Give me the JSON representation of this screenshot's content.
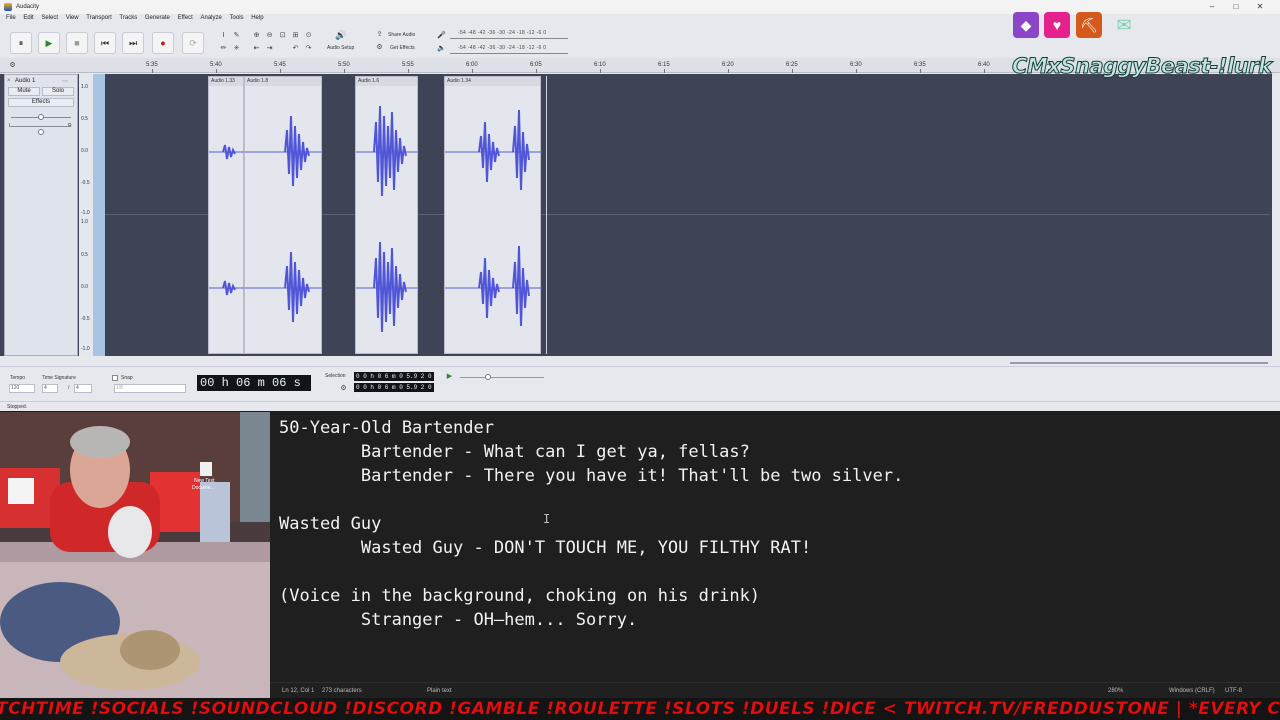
{
  "audacity": {
    "title": "Audacity",
    "menu": [
      "File",
      "Edit",
      "Select",
      "View",
      "Transport",
      "Tracks",
      "Generate",
      "Effect",
      "Analyze",
      "Tools",
      "Help"
    ],
    "toolbar": {
      "pause": "⏸",
      "play": "▶",
      "stop": "■",
      "skip_start": "⏮",
      "skip_end": "⏭",
      "record": "●",
      "loop": "⟳",
      "audio_setup": "Audio Setup",
      "share_audio": "Share Audio",
      "get_effects": "Get Effects",
      "meter_scale": "-54 -48 -42 -36 -30 -24 -18 -12 -6  0"
    },
    "ruler_ticks": [
      "5:35",
      "5:40",
      "5:45",
      "5:50",
      "5:55",
      "6:00",
      "6:05",
      "6:10",
      "6:15",
      "6:20",
      "6:25",
      "6:30",
      "6:35",
      "6:40",
      "6:45"
    ],
    "track": {
      "name": "Audio 1",
      "mute": "Mute",
      "solo": "Solo",
      "effects": "Effects",
      "gain_l": "L",
      "gain_r": "R",
      "scale": [
        "1.0",
        "0.5",
        "0.0",
        "-0.5",
        "-1.0",
        "1.0",
        "0.5",
        "0.0",
        "-0.5",
        "-1.0"
      ]
    },
    "clips": [
      {
        "name": "Audio 1.33"
      },
      {
        "name": "Audio 1.8"
      },
      {
        "name": "Audio 1.6"
      },
      {
        "name": "Audio 1.34"
      }
    ],
    "selection_bar": {
      "tempo_label": "Tempo",
      "tempo_value": "120",
      "time_sig_label": "Time Signature",
      "time_sig_num": "4",
      "time_sig_den": "4",
      "snap_label": "Snap",
      "snap_value": "1/8",
      "time_display": "00 h 06 m 06 s",
      "selection_label": "Selection",
      "sel_start": "0 0 h 0 6 m 0 5.9 2 0 s",
      "sel_end": "0 0 h 0 6 m 0 5.9 2 0 s"
    },
    "status": "Stopped."
  },
  "overlay": {
    "streamer_name": "CMxSnaggyBeast-!lurk",
    "icon_colors": {
      "gem": "#8c45c8",
      "heart": "#e5218c",
      "cart": "#d45a1c",
      "twitch": "#7ecfb3"
    }
  },
  "webcam": {
    "desktop_file_label_1": "New Text",
    "desktop_file_label_2": "Docume..."
  },
  "notepad": {
    "lines": [
      "50-Year-Old Bartender",
      "        Bartender - What can I get ya, fellas?",
      "        Bartender - There you have it! That'll be two silver.",
      "",
      "Wasted Guy",
      "        Wasted Guy - DON'T TOUCH ME, YOU FILTHY RAT!",
      "",
      "(Voice in the background, choking on his drink)",
      "        Stranger - OH—hem... Sorry."
    ],
    "cursor_glyph": "I",
    "status": {
      "position": "Ln 12, Col 1",
      "chars": "273 characters",
      "format": "Plain text",
      "zoom": "280%",
      "eol": "Windows (CRLF)",
      "encoding": "UTF-8"
    }
  },
  "ticker": {
    "text": "TCHTIME  !SOCIALS  !SOUNDCLOUD  !DISCORD  !GAMBLE  !ROULETTE  !SLOTS  !DUELS  !DICE  < TWITCH.TV/FREDDUSTONE  |  *EVERY CHAT"
  }
}
